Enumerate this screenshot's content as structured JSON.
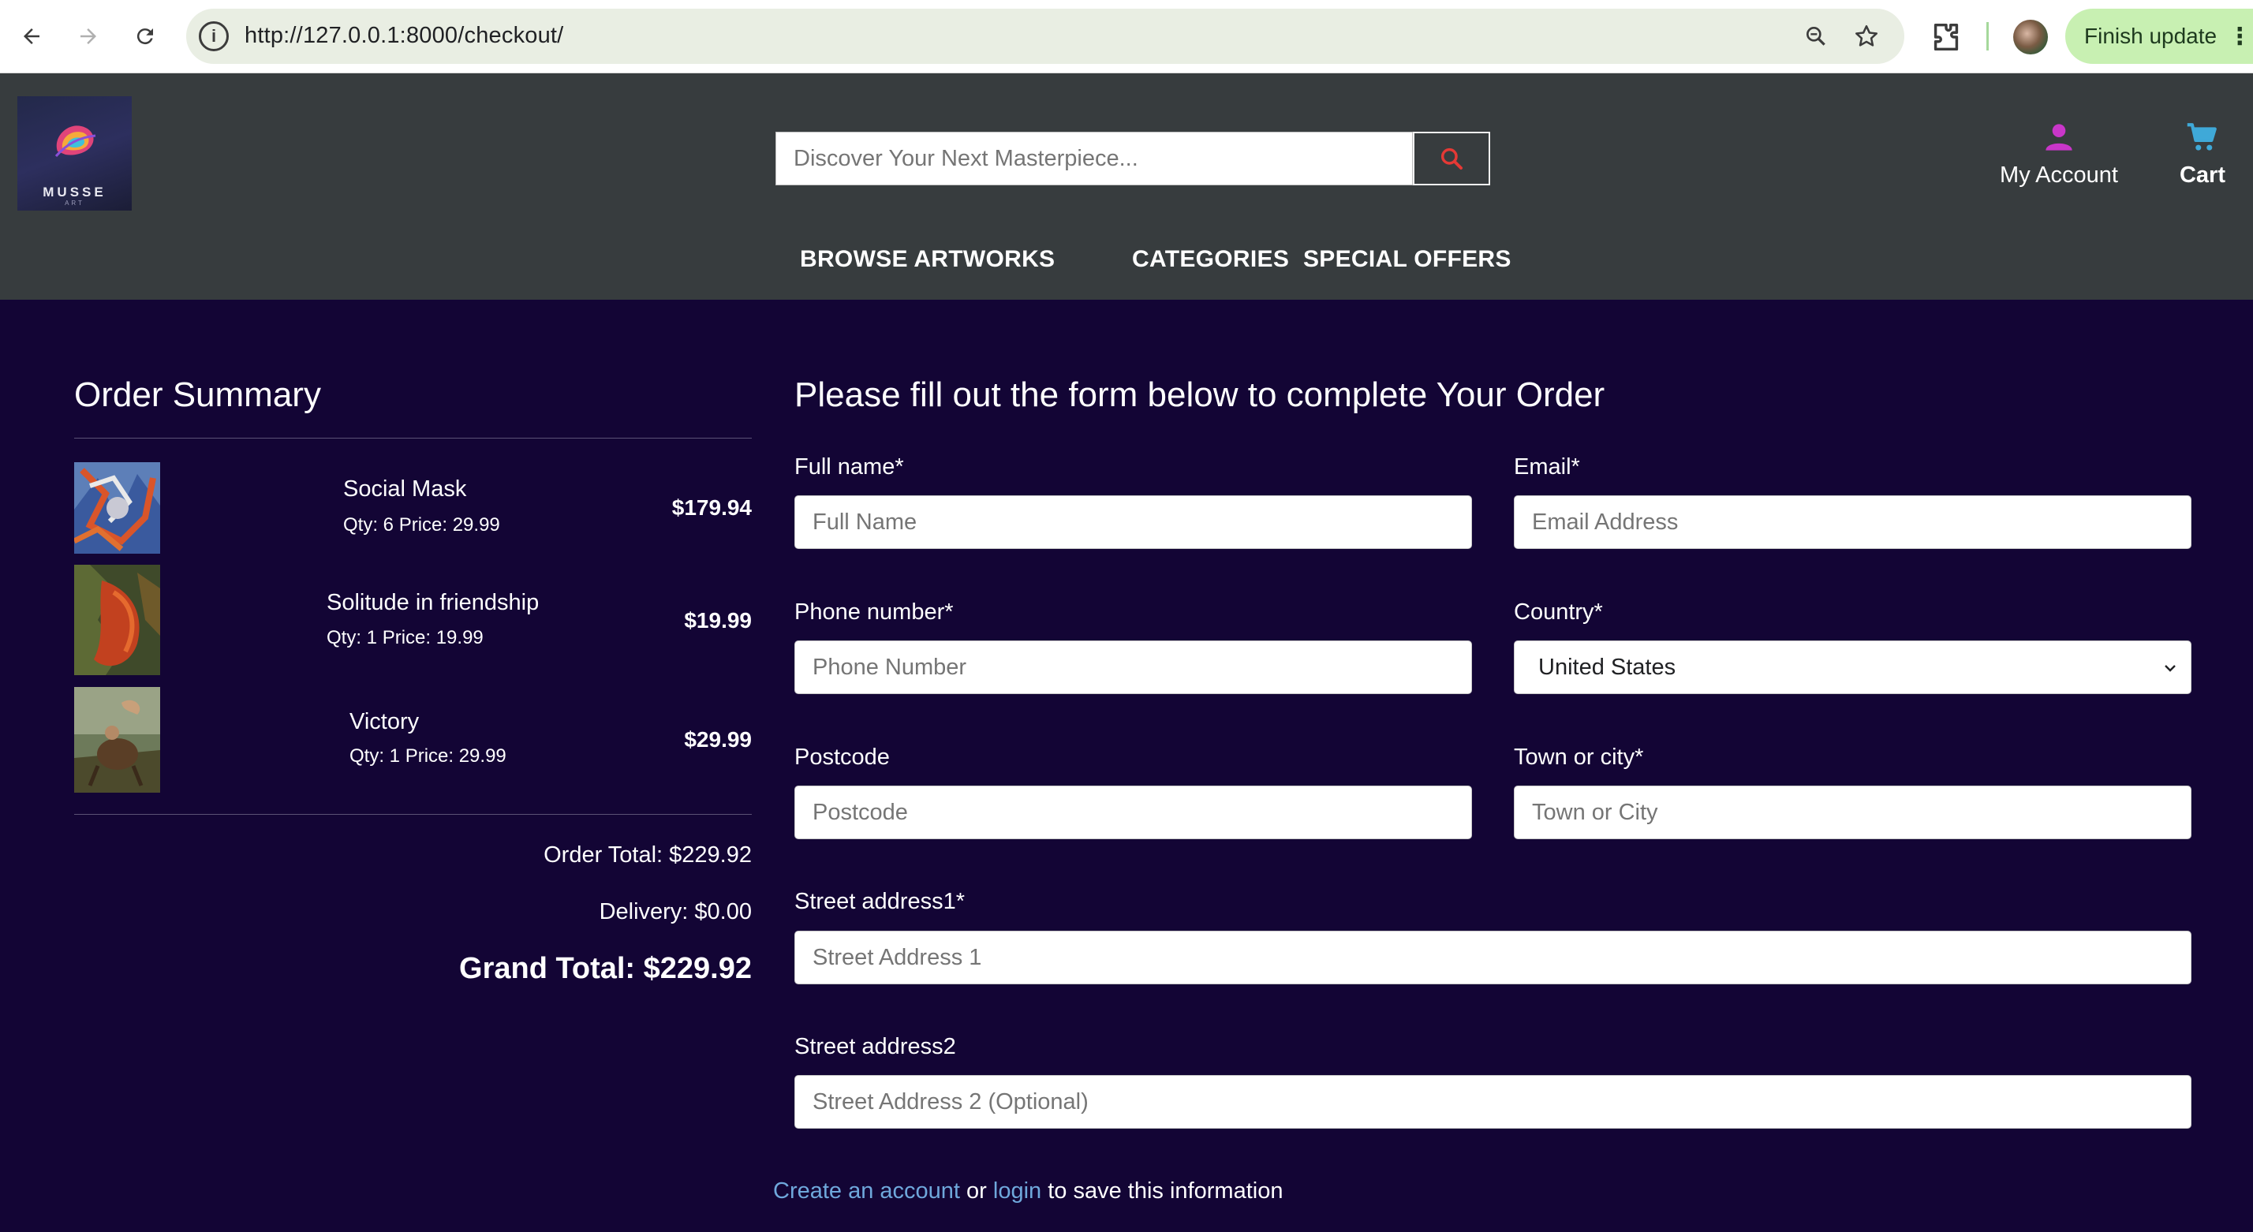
{
  "browser": {
    "url": "http://127.0.0.1:8000/checkout/",
    "update_button": "Finish update"
  },
  "header": {
    "logo_text": "MUSSE",
    "logo_subtext": "ART",
    "search_placeholder": "Discover Your Next Masterpiece...",
    "account_label": "My Account",
    "cart_label": "Cart",
    "nav": [
      "BROWSE ARTWORKS",
      "CATEGORIES",
      "SPECIAL OFFERS"
    ]
  },
  "summary": {
    "title": "Order Summary",
    "items": [
      {
        "name": "Social Mask",
        "meta": "Qty: 6 Price: 29.99",
        "total": "$179.94"
      },
      {
        "name": "Solitude in friendship",
        "meta": "Qty: 1 Price: 19.99",
        "total": "$19.99"
      },
      {
        "name": "Victory",
        "meta": "Qty: 1 Price: 29.99",
        "total": "$29.99"
      }
    ],
    "order_total": "Order Total: $229.92",
    "delivery": "Delivery: $0.00",
    "grand_total": "Grand Total: $229.92"
  },
  "form": {
    "heading": "Please fill out the form below to complete Your Order",
    "full_name": {
      "label": "Full name*",
      "placeholder": "Full Name"
    },
    "email": {
      "label": "Email*",
      "placeholder": "Email Address"
    },
    "phone": {
      "label": "Phone number*",
      "placeholder": "Phone Number"
    },
    "country": {
      "label": "Country*",
      "value": "United States"
    },
    "postcode": {
      "label": "Postcode",
      "placeholder": "Postcode"
    },
    "town": {
      "label": "Town or city*",
      "placeholder": "Town or City"
    },
    "street1": {
      "label": "Street address1*",
      "placeholder": "Street Address 1"
    },
    "street2": {
      "label": "Street address2",
      "placeholder": "Street Address 2 (Optional)"
    },
    "save_info": {
      "create_account": "Create an account",
      "or": "or",
      "login": "login",
      "suffix": "to save this information"
    }
  },
  "colors": {
    "header_bg": "#373c3e",
    "page_bg": "#130535",
    "account_icon": "#c936c9",
    "cart_icon": "#3fa9d8",
    "search_icon": "#e53935",
    "link": "#6fa8dc"
  }
}
